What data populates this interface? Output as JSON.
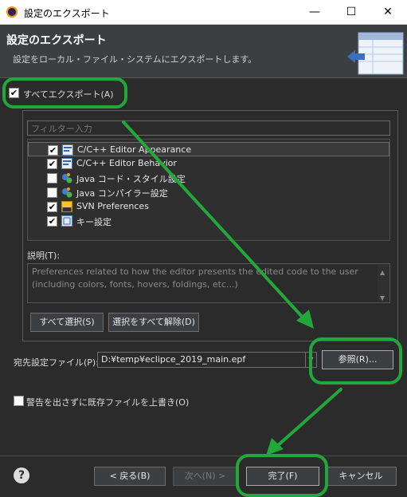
{
  "window": {
    "title": "設定のエクスポート",
    "minimize_glyph": "—",
    "maximize_glyph": "☐",
    "close_glyph": "✕"
  },
  "header": {
    "title": "設定のエクスポート",
    "description": "設定をローカル・ファイル・システムにエクスポートします。"
  },
  "export_all": {
    "label": "すべてエクスポート(A)",
    "checked": true
  },
  "filter": {
    "placeholder": "フィルター入力"
  },
  "tree": {
    "items": [
      {
        "label": "C/C++ Editor Appearance",
        "checked": true,
        "icon": "cpp-editor-icon",
        "selected": true
      },
      {
        "label": "C/C++ Editor Behavior",
        "checked": true,
        "icon": "cpp-editor-icon",
        "selected": false
      },
      {
        "label": "Java コード・スタイル設定",
        "checked": false,
        "icon": "java-icon",
        "selected": false
      },
      {
        "label": "Java コンパイラー設定",
        "checked": false,
        "icon": "java-icon",
        "selected": false
      },
      {
        "label": "SVN Preferences",
        "checked": true,
        "icon": "svn-icon",
        "selected": false
      },
      {
        "label": "キー設定",
        "checked": true,
        "icon": "keys-icon",
        "selected": false
      }
    ]
  },
  "description": {
    "label": "説明(T):",
    "text": "Preferences related to how the editor presents the edited code to the user (including colors, fonts, hovers, foldings, etc...)"
  },
  "buttons": {
    "select_all": "すべて選択(S)",
    "deselect_all": "選択をすべて解除(D)",
    "browse": "参照(R)...",
    "back": "< 戻る(B)",
    "next": "次へ(N) >",
    "finish": "完了(F)",
    "cancel": "キャンセル"
  },
  "destination": {
    "label": "宛先設定ファイル(P):",
    "value": "D:¥temp¥eclipce_2019_main.epf"
  },
  "overwrite": {
    "label": "警告を出さずに既存ファイルを上書き(O)",
    "checked": false
  },
  "help": {
    "glyph": "?"
  },
  "colors": {
    "annotation_green": "#22a83a",
    "background": "#2b2b2b",
    "header": "#3c3f41"
  }
}
